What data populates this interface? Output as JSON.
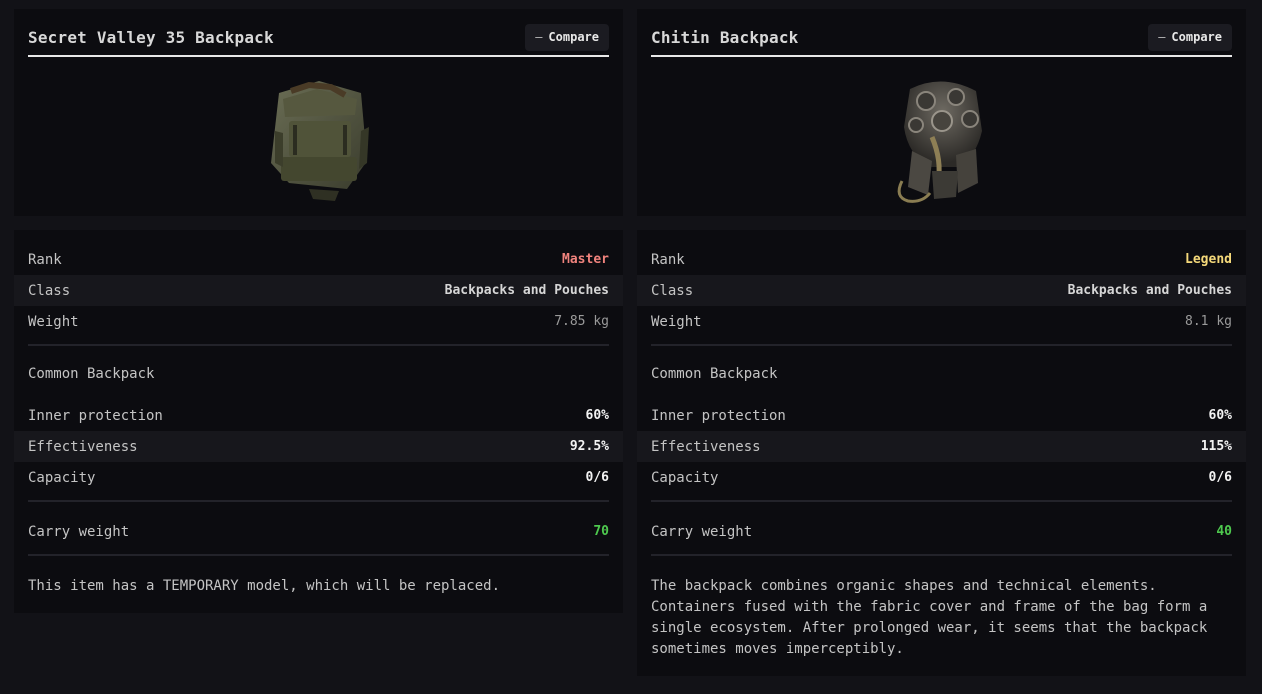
{
  "compare_label": "Compare",
  "items": [
    {
      "title": "Secret Valley 35 Backpack",
      "image_icon": "backpack-green-icon",
      "rank_label": "Rank",
      "rank": "Master",
      "rank_color": "#f0837d",
      "class_label": "Class",
      "class": "Backpacks and Pouches",
      "weight_label": "Weight",
      "weight": "7.85 kg",
      "category": "Common Backpack",
      "inner_protection_label": "Inner protection",
      "inner_protection": "60%",
      "effectiveness_label": "Effectiveness",
      "effectiveness": "92.5%",
      "capacity_label": "Capacity",
      "capacity": "0/6",
      "carry_weight_label": "Carry weight",
      "carry_weight": "70",
      "description": "This item has a TEMPORARY model, which will be replaced."
    },
    {
      "title": "Chitin Backpack",
      "image_icon": "backpack-chitin-icon",
      "rank_label": "Rank",
      "rank": "Legend",
      "rank_color": "#f5d97a",
      "class_label": "Class",
      "class": "Backpacks and Pouches",
      "weight_label": "Weight",
      "weight": "8.1 kg",
      "category": "Common Backpack",
      "inner_protection_label": "Inner protection",
      "inner_protection": "60%",
      "effectiveness_label": "Effectiveness",
      "effectiveness": "115%",
      "capacity_label": "Capacity",
      "capacity": "0/6",
      "carry_weight_label": "Carry weight",
      "carry_weight": "40",
      "description": "The backpack combines organic shapes and technical elements. Containers fused with the fabric cover and frame of the bag form a single ecosystem. After prolonged wear, it seems that the backpack sometimes moves imperceptibly."
    }
  ],
  "colors": {
    "positive": "#4ec94e",
    "value_white": "#f2f2f2",
    "weight_gray": "#9a9a9a"
  }
}
